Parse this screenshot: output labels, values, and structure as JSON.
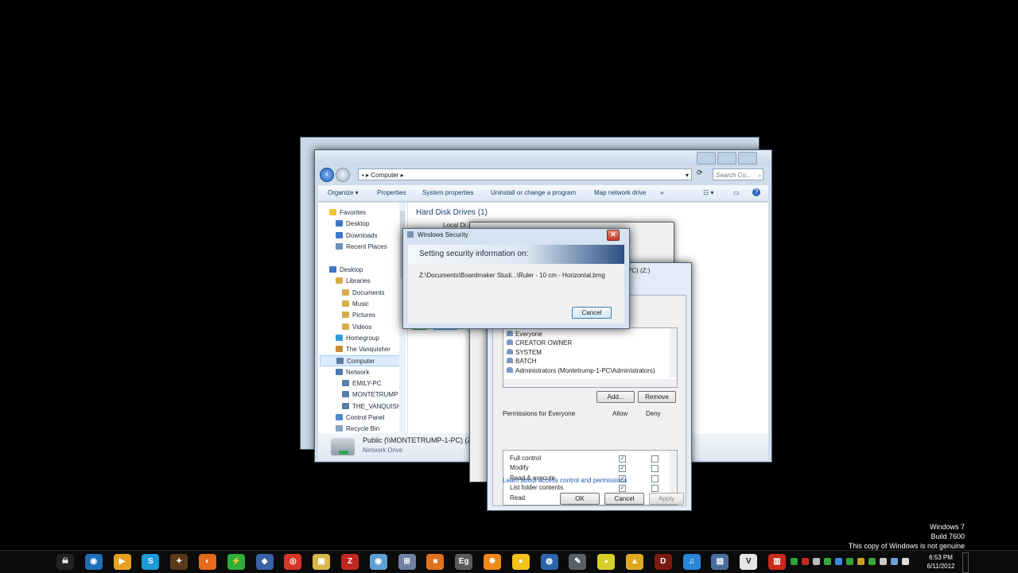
{
  "explorer": {
    "breadcrumb": "Computer",
    "search_placeholder": "Search Co...",
    "toolbar": [
      "Organize ▾",
      "Properties",
      "System properties",
      "Uninstall or change a program",
      "Map network drive",
      "»"
    ],
    "nav": [
      "Favorites",
      "Desktop",
      "Downloads",
      "Recent Places",
      "Desktop",
      "Libraries",
      "Documents",
      "Music",
      "Pictures",
      "Videos",
      "Homegroup",
      "The Vanquisher",
      "Computer",
      "Network",
      "EMILY-PC",
      "MONTETRUMP",
      "THE_VANQUISH",
      "Control Panel",
      "Recycle Bin"
    ],
    "section_header": "Hard Disk Drives (1)",
    "local_disk_partial": "Local Di",
    "details_title": "Public (\\\\MONTETRUMP-1-PC) (Z:)",
    "details_subtitle": "Network Drive"
  },
  "props": {
    "title_partial": "PC) (Z:)",
    "groups": [
      "Everyone",
      "CREATOR OWNER",
      "SYSTEM",
      "BATCH",
      "Administrators (Montetrump-1-PC\\Administrators)"
    ],
    "add_label": "Add...",
    "remove_label": "Remove",
    "perm_header": "Permissions for Everyone",
    "allow_label": "Allow",
    "deny_label": "Deny",
    "permissions": [
      {
        "name": "Full control",
        "allow": true,
        "deny": false
      },
      {
        "name": "Modify",
        "allow": true,
        "deny": false
      },
      {
        "name": "Read & execute",
        "allow": true,
        "deny": false
      },
      {
        "name": "List folder contents",
        "allow": true,
        "deny": false
      },
      {
        "name": "Read",
        "allow": true,
        "deny": false
      }
    ],
    "link": "Learn about access control and permissions",
    "ok_label": "OK",
    "cancel_label": "Cancel",
    "apply_label": "Apply"
  },
  "security_dialog": {
    "title": "Windows Security",
    "heading": "Setting security information on:",
    "path": "Z:\\Documents\\Boardmaker Studi...\\Ruler - 10 cm - Horizontal.bmg",
    "cancel_label": "Cancel"
  },
  "watermark": {
    "line1": "Windows 7",
    "line2": "Build 7600",
    "line3": "This copy of Windows is not genuine"
  },
  "taskbar": {
    "time": "6:53 PM",
    "date": "6/11/2012",
    "apps": [
      {
        "name": "skull-icon",
        "color": "#222222",
        "glyph": "☠"
      },
      {
        "name": "app-blue-icon",
        "color": "#1d6fb8",
        "glyph": "◉"
      },
      {
        "name": "media-player-icon",
        "color": "#e8a020",
        "glyph": "▶"
      },
      {
        "name": "skype-icon",
        "color": "#1a9ad6",
        "glyph": "S"
      },
      {
        "name": "pirate-icon",
        "color": "#5a3a1a",
        "glyph": "✦"
      },
      {
        "name": "firefox-icon",
        "color": "#e66a1c",
        "glyph": "◐"
      },
      {
        "name": "lightning-icon",
        "color": "#2fae3c",
        "glyph": "⚡"
      },
      {
        "name": "virtualbox-icon",
        "color": "#3a62a8",
        "glyph": "◆"
      },
      {
        "name": "chrome-icon",
        "color": "#d8342a",
        "glyph": "◎"
      },
      {
        "name": "folder-app-icon",
        "color": "#d9b64a",
        "glyph": "▣"
      },
      {
        "name": "filezilla-icon",
        "color": "#c0271f",
        "glyph": "Z"
      },
      {
        "name": "eye-icon",
        "color": "#5f9fd4",
        "glyph": "◉"
      },
      {
        "name": "network-app-icon",
        "color": "#6f7fa0",
        "glyph": "⊞"
      },
      {
        "name": "box-app-icon",
        "color": "#e0721e",
        "glyph": "■"
      },
      {
        "name": "eg-icon",
        "color": "#5a5a5a",
        "glyph": "Eg"
      },
      {
        "name": "gear-app-icon",
        "color": "#f08a1a",
        "glyph": "✹"
      },
      {
        "name": "duck-icon",
        "color": "#f5c21a",
        "glyph": "●"
      },
      {
        "name": "globe-app-icon",
        "color": "#2c64a8",
        "glyph": "◍"
      },
      {
        "name": "tool-icon",
        "color": "#5a5f66",
        "glyph": "✎"
      },
      {
        "name": "ball-icon",
        "color": "#d7d02a",
        "glyph": "◕"
      },
      {
        "name": "lock-app-icon",
        "color": "#e0a820",
        "glyph": "▲"
      },
      {
        "name": "diablo-icon",
        "color": "#7a1a10",
        "glyph": "D"
      },
      {
        "name": "itunes-icon",
        "color": "#2a86d8",
        "glyph": "♫"
      },
      {
        "name": "monitor-app-icon",
        "color": "#4a6f9e",
        "glyph": "▤"
      },
      {
        "name": "vnc-icon",
        "color": "#e6e6e6",
        "glyph": "V"
      },
      {
        "name": "red-app-icon",
        "color": "#c82a1e",
        "glyph": "▥"
      }
    ],
    "tray": [
      "#2aa33a",
      "#c8281e",
      "#bbbbbb",
      "#3aa63a",
      "#3c8ad8",
      "#2aa33a",
      "#c8a020",
      "#3aa63a",
      "#c8c8c8",
      "#6f9fd8",
      "#dddddd"
    ]
  }
}
